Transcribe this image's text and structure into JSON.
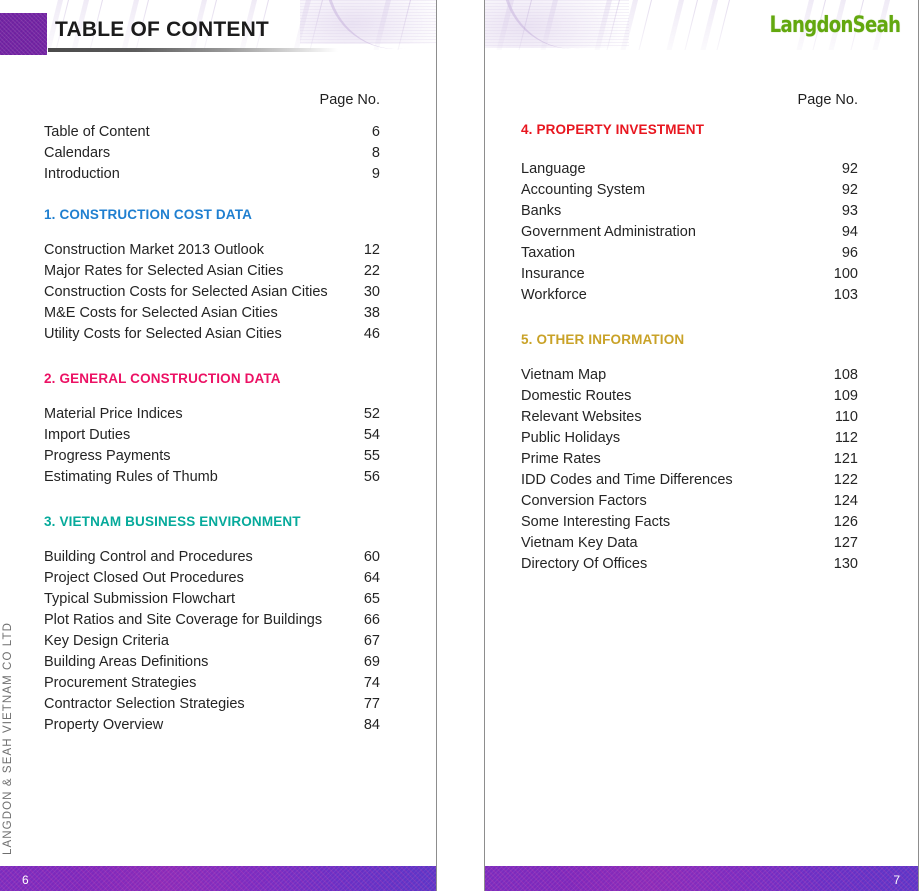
{
  "spread": {
    "heading": "TABLE OF CONTENT",
    "logo": "LangdonSeah",
    "side_caption": "LANGDON & SEAH VIETNAM CO LTD",
    "page_no_label": "Page No.",
    "colors": {
      "corner_block": "#6d22a0",
      "logo_green": "#63a80f",
      "section_1_blue": "#1f7fd0",
      "section_2_pink": "#ec1164",
      "section_3_teal": "#06aa9b",
      "section_4_red": "#e8161f",
      "section_5_gold": "#c9a227",
      "footer_purple": "#7b2bbd"
    }
  },
  "left_page": {
    "footer_page_number": "6",
    "page_no_label": "Page No.",
    "front_matter": [
      {
        "label": "Table of Content",
        "page": "6"
      },
      {
        "label": "Calendars",
        "page": "8"
      },
      {
        "label": "Introduction",
        "page": "9"
      }
    ],
    "sections": [
      {
        "title": "1. CONSTRUCTION COST DATA",
        "color": "#1f7fd0",
        "entries": [
          {
            "label": "Construction Market 2013 Outlook",
            "page": "12"
          },
          {
            "label": "Major Rates for Selected Asian Cities",
            "page": "22"
          },
          {
            "label": "Construction Costs for Selected Asian Cities",
            "page": "30"
          },
          {
            "label": "M&E Costs for Selected Asian Cities",
            "page": "38"
          },
          {
            "label": "Utility Costs for Selected Asian Cities",
            "page": "46"
          }
        ]
      },
      {
        "title": "2. GENERAL CONSTRUCTION DATA",
        "color": "#ec1164",
        "entries": [
          {
            "label": "Material Price Indices",
            "page": "52"
          },
          {
            "label": "Import Duties",
            "page": "54"
          },
          {
            "label": "Progress Payments",
            "page": "55"
          },
          {
            "label": "Estimating Rules of Thumb",
            "page": "56"
          }
        ]
      },
      {
        "title": "3. VIETNAM BUSINESS ENVIRONMENT",
        "color": "#06aa9b",
        "entries": [
          {
            "label": "Building Control and Procedures",
            "page": "60"
          },
          {
            "label": "Project Closed Out Procedures",
            "page": "64"
          },
          {
            "label": "Typical Submission Flowchart",
            "page": "65"
          },
          {
            "label": "Plot Ratios and Site Coverage for Buildings",
            "page": "66"
          },
          {
            "label": "Key Design Criteria",
            "page": "67"
          },
          {
            "label": "Building Areas Definitions",
            "page": "69"
          },
          {
            "label": "Procurement Strategies",
            "page": "74"
          },
          {
            "label": "Contractor Selection Strategies",
            "page": "77"
          },
          {
            "label": "Property Overview",
            "page": "84"
          }
        ]
      }
    ]
  },
  "right_page": {
    "footer_page_number": "7",
    "page_no_label": "Page No.",
    "sections": [
      {
        "title": "4. PROPERTY INVESTMENT",
        "color": "#e8161f",
        "entries": [
          {
            "label": "Language",
            "page": "92"
          },
          {
            "label": "Accounting System",
            "page": "92"
          },
          {
            "label": "Banks",
            "page": "93"
          },
          {
            "label": "Government Administration",
            "page": "94"
          },
          {
            "label": "Taxation",
            "page": "96"
          },
          {
            "label": "Insurance",
            "page": "100"
          },
          {
            "label": "Workforce",
            "page": "103"
          }
        ]
      },
      {
        "title": "5. OTHER INFORMATION",
        "color": "#c9a227",
        "entries": [
          {
            "label": "Vietnam Map",
            "page": "108"
          },
          {
            "label": "Domestic Routes",
            "page": "109"
          },
          {
            "label": "Relevant Websites",
            "page": "110"
          },
          {
            "label": "Public Holidays",
            "page": "112"
          },
          {
            "label": "Prime Rates",
            "page": "121"
          },
          {
            "label": "IDD Codes and Time Differences",
            "page": "122"
          },
          {
            "label": "Conversion Factors",
            "page": "124"
          },
          {
            "label": "Some Interesting Facts",
            "page": "126"
          },
          {
            "label": "Vietnam Key Data",
            "page": "127"
          },
          {
            "label": "Directory Of Offices",
            "page": "130"
          }
        ]
      }
    ]
  }
}
